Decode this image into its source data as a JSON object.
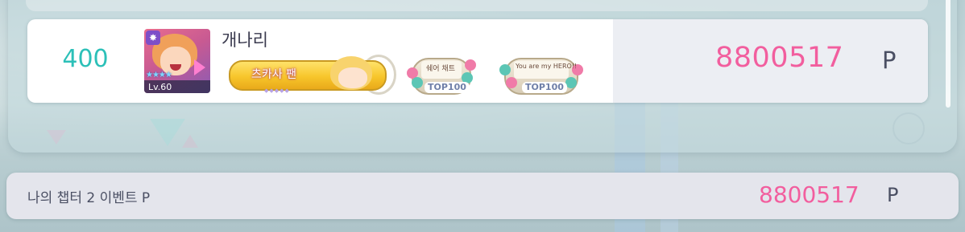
{
  "ranking_entry": {
    "rank": "400",
    "player_name": "개나리",
    "avatar": {
      "level": "Lv.60",
      "stars": "★★★★",
      "attribute_icon": "✸"
    },
    "title_badge": {
      "label": "츠카사 팬"
    },
    "rank_medals": [
      {
        "mini_text": "쉐어 채트",
        "tag": "TOP100"
      },
      {
        "mini_text": "You are my HERO!!",
        "tag": "TOP100"
      }
    ],
    "score": "8800517",
    "score_unit": "P"
  },
  "summary": {
    "label": "나의 챕터 2 이벤트 P",
    "score": "8800517",
    "score_unit": "P"
  },
  "colors": {
    "score_pink": "#f25e9e",
    "rank_teal": "#2cc0b8",
    "text_dark": "#4a4f63"
  }
}
